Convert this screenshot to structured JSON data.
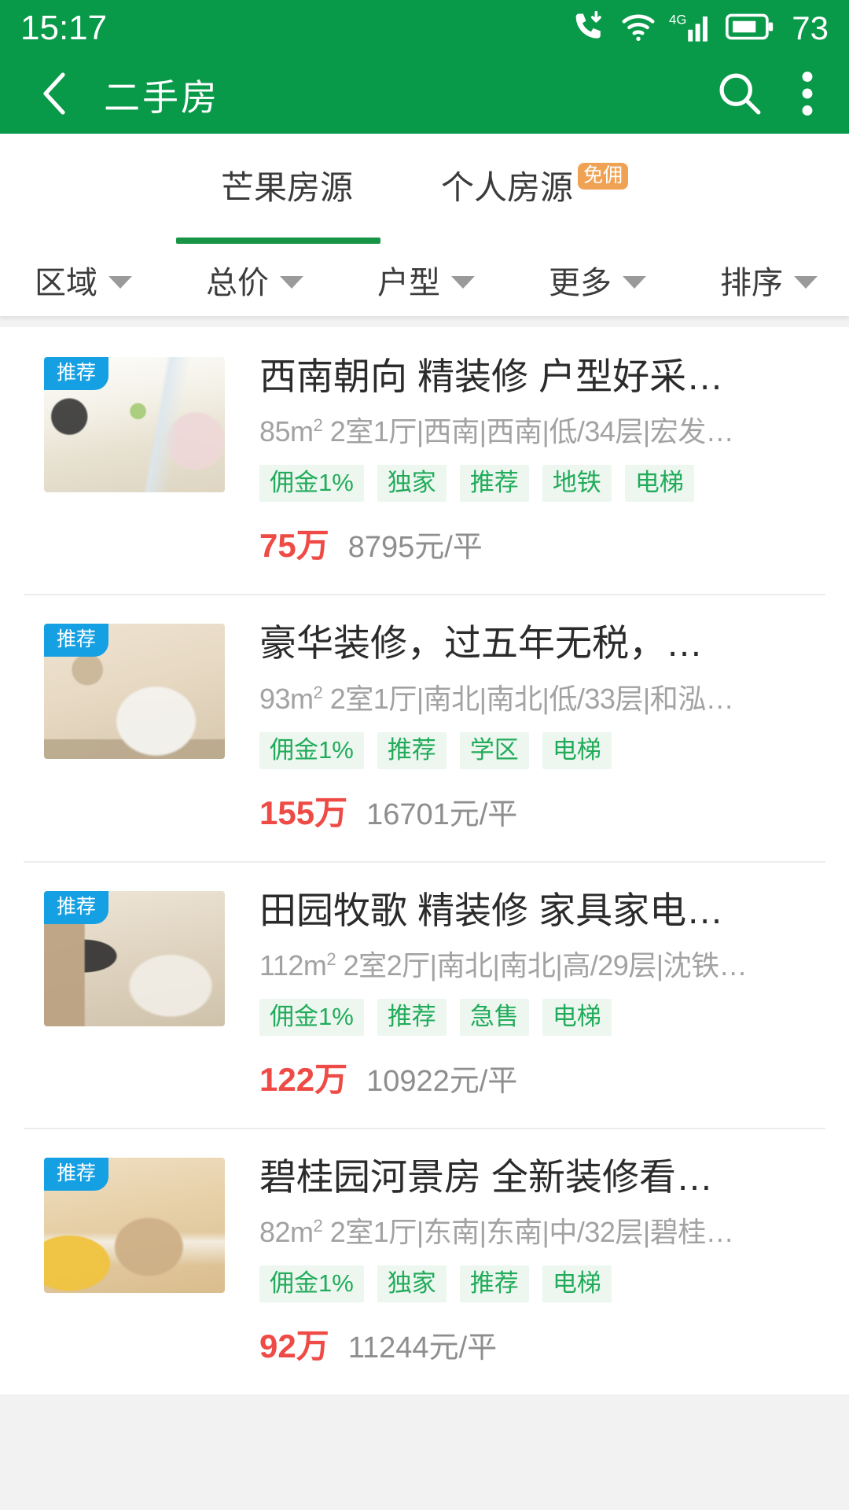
{
  "status_bar": {
    "time": "15:17",
    "battery_level": "73",
    "icons": [
      "call-forward-icon",
      "wifi-icon",
      "signal-4g-icon",
      "battery-icon"
    ],
    "network_label": "4G"
  },
  "app_bar": {
    "title": "二手房",
    "back_icon": "back-chevron-icon",
    "search_icon": "search-icon",
    "overflow_icon": "more-vertical-icon"
  },
  "tabs": [
    {
      "label": "芒果房源",
      "badge": "",
      "active": true
    },
    {
      "label": "个人房源",
      "badge": "免佣",
      "active": false
    }
  ],
  "filters": [
    {
      "label": "区域"
    },
    {
      "label": "总价"
    },
    {
      "label": "户型"
    },
    {
      "label": "更多"
    },
    {
      "label": "排序"
    }
  ],
  "colors": {
    "brand_green": "#089949",
    "tab_underline": "#189447",
    "badge_orange": "#f0a254",
    "badge_blue": "#14a0e2",
    "tag_green": "#21ab5a",
    "tag_bg": "#edf7ef",
    "price_red": "#ef4b46"
  },
  "listings": [
    {
      "badge": "推荐",
      "title": "西南朝向 精装修 户型好采…",
      "area": "85m",
      "area_sup": "2",
      "detail": " 2室1厅|西南|西南|低/34层|宏发…",
      "tags": [
        "佣金1%",
        "独家",
        "推荐",
        "地铁",
        "电梯"
      ],
      "price_total": "75万",
      "price_unit": "8795元/平"
    },
    {
      "badge": "推荐",
      "title": "豪华装修，过五年无税，…",
      "area": "93m",
      "area_sup": "2",
      "detail": " 2室1厅|南北|南北|低/33层|和泓…",
      "tags": [
        "佣金1%",
        "推荐",
        "学区",
        "电梯"
      ],
      "price_total": "155万",
      "price_unit": "16701元/平"
    },
    {
      "badge": "推荐",
      "title": "田园牧歌 精装修 家具家电…",
      "area": "112m",
      "area_sup": "2",
      "detail": " 2室2厅|南北|南北|高/29层|沈铁…",
      "tags": [
        "佣金1%",
        "推荐",
        "急售",
        "电梯"
      ],
      "price_total": "122万",
      "price_unit": "10922元/平"
    },
    {
      "badge": "推荐",
      "title": "碧桂园河景房 全新装修看…",
      "area": "82m",
      "area_sup": "2",
      "detail": " 2室1厅|东南|东南|中/32层|碧桂…",
      "tags": [
        "佣金1%",
        "独家",
        "推荐",
        "电梯"
      ],
      "price_total": "92万",
      "price_unit": "11244元/平"
    }
  ]
}
